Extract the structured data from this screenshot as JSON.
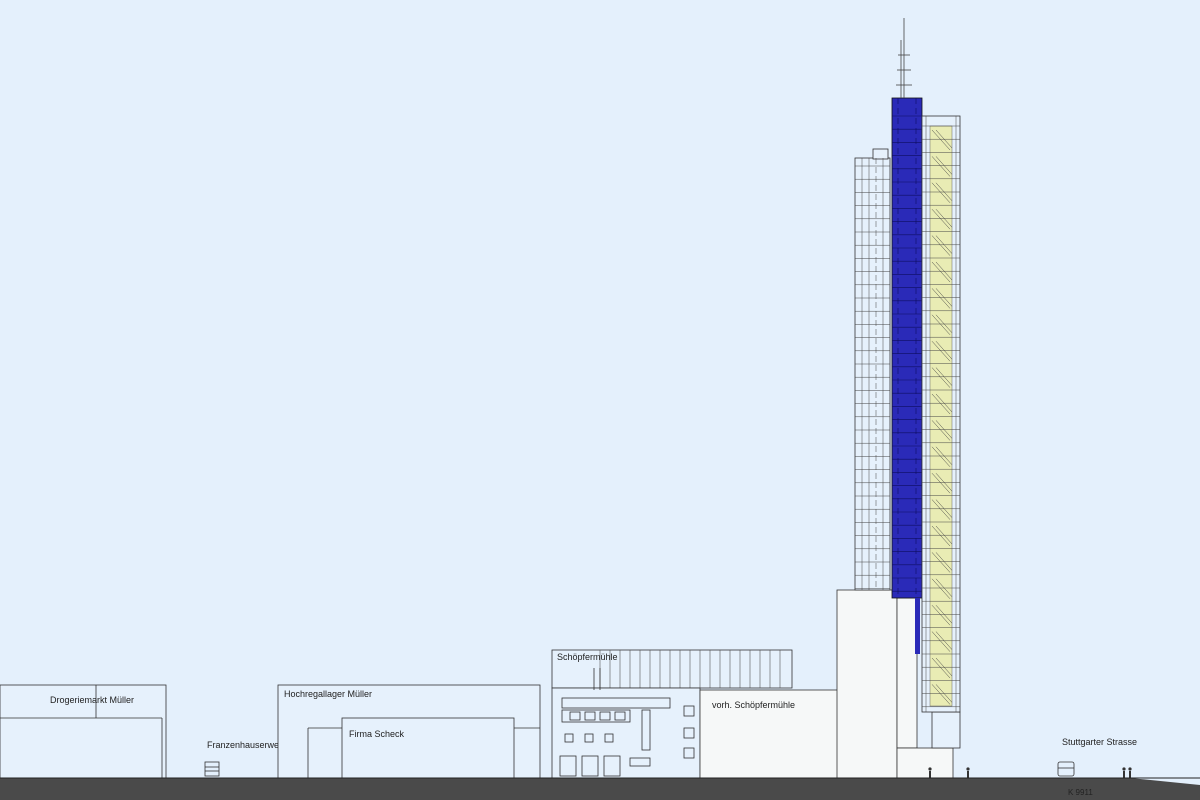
{
  "labels": {
    "drogeriemarkt": "Drogeriemarkt Müller",
    "franzenhauserweg": "Franzenhauserweg",
    "hochregallager": "Hochregallager Müller",
    "firma_scheck": "Firma Scheck",
    "schoepfermuehle": "Schöpfermühle",
    "vorh_schoepfermuehle": "vorh. Schöpfermühle",
    "stuttgarter_strasse": "Stuttgarter Strasse",
    "road_code": "K 9911"
  },
  "colors": {
    "sky": "#e4f0fc",
    "ground": "#4a4a4a",
    "core_blue": "#2a2ab8",
    "stair_yellow": "#e9ecb4",
    "outline": "#333333",
    "building_fill": "#e6f1fc",
    "podium_fill": "#f6f8f8"
  }
}
